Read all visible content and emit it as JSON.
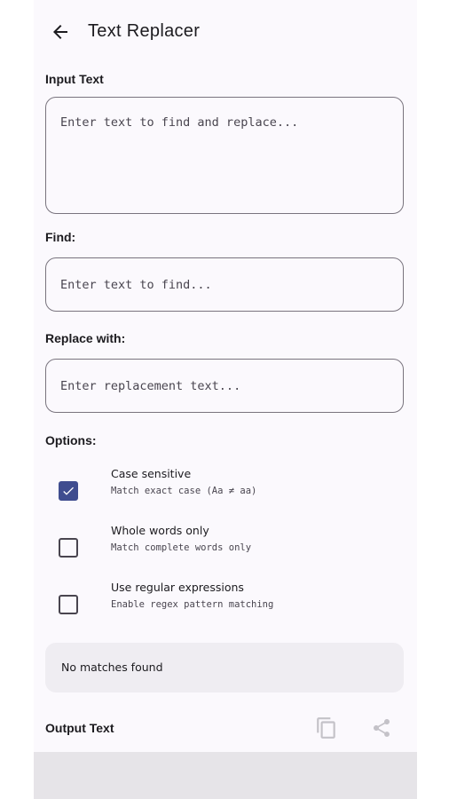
{
  "appbar": {
    "title": "Text Replacer",
    "back_icon": "arrow-left-icon"
  },
  "input": {
    "label": "Input Text",
    "placeholder": "Enter text to find and replace...",
    "value": ""
  },
  "find": {
    "label": "Find:",
    "placeholder": "Enter text to find...",
    "value": ""
  },
  "replace": {
    "label": "Replace with:",
    "placeholder": "Enter replacement text...",
    "value": ""
  },
  "options": {
    "label": "Options:",
    "items": [
      {
        "title": "Case sensitive",
        "subtitle": "Match exact case (Aa ≠ aa)",
        "checked": true
      },
      {
        "title": "Whole words only",
        "subtitle": "Match complete words only",
        "checked": false
      },
      {
        "title": "Use regular expressions",
        "subtitle": "Enable regex pattern matching",
        "checked": false
      }
    ]
  },
  "status": {
    "text": "No matches found"
  },
  "output": {
    "label": "Output Text",
    "copy_icon": "copy-icon",
    "share_icon": "share-icon"
  },
  "colors": {
    "accent": "#3f4d8f",
    "background": "#fbf9fd",
    "outline": "#79747e",
    "status_bg": "#efedf2"
  }
}
